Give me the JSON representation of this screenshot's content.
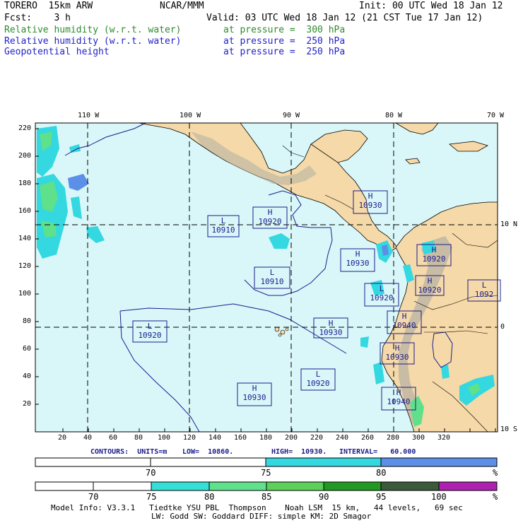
{
  "header": {
    "model": "TORERO  15km ARW",
    "center": "NCAR/MMM",
    "init": "Init: 00 UTC Wed 18 Jan 12",
    "fcst": "Fcst:    3 h",
    "valid": "Valid: 03 UTC Wed 18 Jan 12 (21 CST Tue 17 Jan 12)",
    "field1_name": "Relative humidity (w.r.t. water)",
    "field1_level": "at pressure =  300 hPa",
    "field2_name": "Relative humidity (w.r.t. water)",
    "field2_level": "at pressure =  250 hPa",
    "field3_name": "Geopotential height",
    "field3_level": "at pressure =  250 hPa"
  },
  "map": {
    "lon_labels": [
      "110 W",
      "100 W",
      "90 W",
      "80 W",
      "70 W"
    ],
    "lat_labels": [
      "10 N",
      "0",
      "10 S"
    ],
    "y_ticks": [
      "220",
      "200",
      "180",
      "160",
      "140",
      "120",
      "100",
      "80",
      "60",
      "40",
      "20"
    ],
    "x_ticks": [
      "20",
      "40",
      "60",
      "80",
      "100",
      "120",
      "140",
      "160",
      "180",
      "200",
      "220",
      "240",
      "260",
      "280",
      "300",
      "320"
    ],
    "pressure_systems": [
      {
        "type": "L",
        "value": "10910"
      },
      {
        "type": "H",
        "value": "10920"
      },
      {
        "type": "H",
        "value": "10930"
      },
      {
        "type": "H",
        "value": "10930"
      },
      {
        "type": "H",
        "value": "10920"
      },
      {
        "type": "L",
        "value": "10910"
      },
      {
        "type": "L",
        "value": "10920"
      },
      {
        "type": "L",
        "value": "10920"
      },
      {
        "type": "L",
        "value": "1092"
      },
      {
        "type": "H",
        "value": "10920"
      },
      {
        "type": "H",
        "value": "10930"
      },
      {
        "type": "H",
        "value": "10940"
      },
      {
        "type": "H",
        "value": "10930"
      },
      {
        "type": "L",
        "value": "10920"
      },
      {
        "type": "H",
        "value": "10930"
      },
      {
        "type": "H",
        "value": "10940"
      }
    ],
    "colors": {
      "ocean": "#d9f7f9",
      "land": "#f5d9a8",
      "contour": "#1c1c8c",
      "rh_light": "#5fe08a",
      "rh_cyan": "#33d8e0",
      "rh_blue": "#5c90e8"
    }
  },
  "contour_info": {
    "units": "CONTOURS:  UNITS=m",
    "low": "LOW=  10860.",
    "high": "HIGH=  10930.",
    "interval": "INTERVAL=   60.000"
  },
  "colorbar1": {
    "labels": [
      "70",
      "75",
      "80",
      "%"
    ],
    "colors": [
      "#ffffff",
      "#ffffff",
      "#33d8e0",
      "#5c90e8"
    ]
  },
  "colorbar2": {
    "labels": [
      "70",
      "75",
      "80",
      "85",
      "90",
      "95",
      "100",
      "%"
    ],
    "colors": [
      "#ffffff",
      "#ffffff",
      "#33e0d8",
      "#5fe08a",
      "#5dd05a",
      "#229922",
      "#3a5a3a",
      "#b020b0"
    ]
  },
  "footer": {
    "line1": "Model Info: V3.3.1   Tiedtke YSU PBL  Thompson    Noah LSM  15 km,   44 levels,   69 sec",
    "line2": "LW: Godd SW: Goddard DIFF: simple KM: 2D Smagor"
  }
}
